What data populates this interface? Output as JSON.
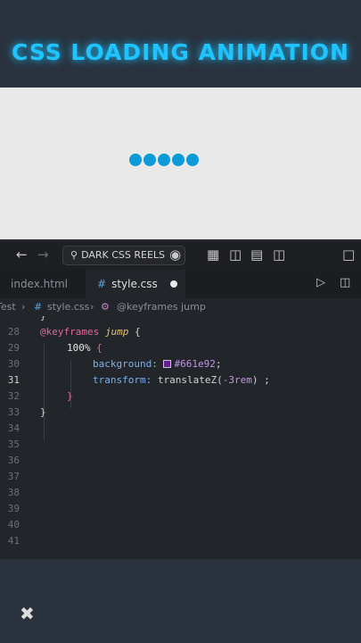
{
  "banner": {
    "title": "CSS LOADING ANIMATION"
  },
  "preview": {
    "dot_count": 5,
    "dot_color": "#0b9bd6"
  },
  "titlebar": {
    "search_label": "DARK CSS REELS",
    "icons": [
      "arrow-left-icon",
      "arrow-right-icon",
      "search-icon",
      "copilot-icon",
      "layout-icon",
      "sidebar-left-icon",
      "panel-bottom-icon",
      "sidebar-right-icon",
      "window-square-icon"
    ]
  },
  "tabs": [
    {
      "label": "index.html",
      "active": false
    },
    {
      "label": "style.css",
      "active": true,
      "modified": true
    }
  ],
  "breadcrumb": {
    "folder": "Test",
    "file": "style.css",
    "symbol": "@keyframes jump"
  },
  "editor": {
    "active_line": 31,
    "lines": [
      {
        "num": "",
        "text": "}"
      },
      {
        "num": "28",
        "text": "@keyframes jump {"
      },
      {
        "num": "29",
        "text": "100% {"
      },
      {
        "num": "30",
        "text": "background: #661e92;"
      },
      {
        "num": "31",
        "text": "transform: translateZ(-3rem) ;"
      },
      {
        "num": "32",
        "text": "}"
      },
      {
        "num": "33",
        "text": "}"
      },
      {
        "num": "34",
        "text": ""
      },
      {
        "num": "35",
        "text": ""
      },
      {
        "num": "36",
        "text": ""
      },
      {
        "num": "37",
        "text": ""
      },
      {
        "num": "38",
        "text": ""
      },
      {
        "num": "39",
        "text": ""
      },
      {
        "num": "40",
        "text": ""
      },
      {
        "num": "41",
        "text": ""
      }
    ],
    "tokens": {
      "at_rule": "@keyframes",
      "anim_name": "jump",
      "open_brace": "{",
      "close_brace": "}",
      "selector": "100%",
      "prop_bg": "background:",
      "val_bg": "#661e92",
      "semicolon": ";",
      "prop_tf": "transform:",
      "tf_func": "translateZ(",
      "tf_arg": "-3rem",
      "tf_close": ")",
      "tf_end": " ;"
    },
    "swatch_color": "#661e92"
  },
  "watermark": {
    "icon": "capcut-icon"
  }
}
